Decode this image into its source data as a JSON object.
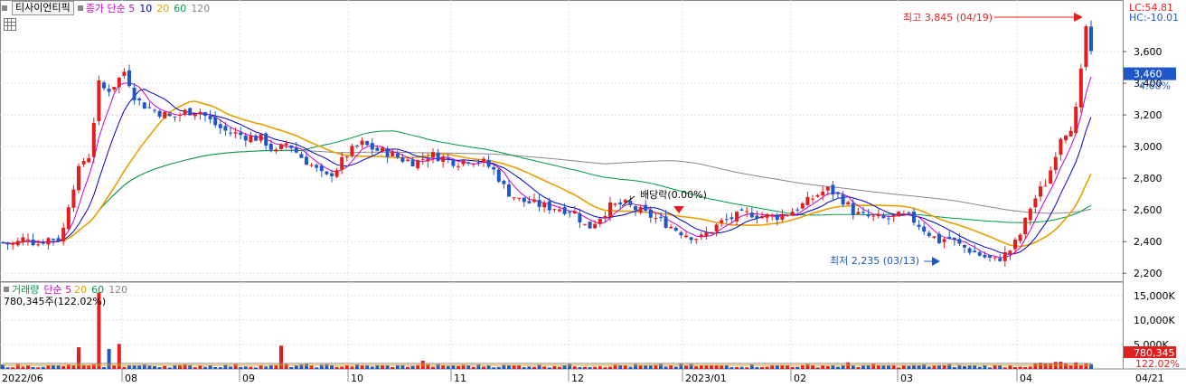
{
  "legend": {
    "title": "티사이언티픽",
    "items": [
      {
        "text": "종가 단순 5",
        "color": "#cc00cc"
      },
      {
        "text": "10",
        "color": "#0000cc"
      },
      {
        "text": "20",
        "color": "#e8a000"
      },
      {
        "text": "60",
        "color": "#009944"
      },
      {
        "text": "120",
        "color": "#888888"
      }
    ]
  },
  "volume_legend": {
    "items": [
      {
        "text": "거래량",
        "color": "#009944"
      },
      {
        "text": "단순 5",
        "color": "#cc00cc"
      },
      {
        "text": "20",
        "color": "#e8a000"
      },
      {
        "text": "60",
        "color": "#009944"
      },
      {
        "text": "120",
        "color": "#888888"
      }
    ],
    "summary": "780,345주(122.02%)"
  },
  "right_info": {
    "lc": "LC:54.81",
    "hc": "HC:-10.01"
  },
  "colors": {
    "up": "#e21f1f",
    "down": "#1f56c8",
    "grid": "#dddddd"
  },
  "chart_data": {
    "type": "candlestick",
    "price_axis": {
      "range": [
        2150,
        3880
      ],
      "ticks": [
        "2,200",
        "2,400",
        "2,600",
        "2,800",
        "3,000",
        "3,200",
        "3,400",
        "3,600"
      ]
    },
    "volume_axis": {
      "range": [
        0,
        17000
      ],
      "ticks": [
        "5,000K",
        "10,000K",
        "15,000K"
      ]
    },
    "x_labels": [
      "2022/06",
      "08",
      "09",
      "10",
      "11",
      "12",
      "2023/01",
      "02",
      "03",
      "04"
    ],
    "last_date_label": "04/21",
    "current_price": "3,460",
    "current_change": "-4.68%",
    "current_volume": "780,345",
    "current_volume_ratio": "122.02%",
    "annotations": {
      "high": "최고 3,845 (04/19)",
      "low": "최저 2,235 (03/13)",
      "dividend": "배당락(0.00%)"
    },
    "ma_colors": {
      "ma5": "#cc00cc",
      "ma10": "#0000cc",
      "ma20": "#e8a000",
      "ma60": "#009944",
      "ma120": "#888888"
    },
    "keypoints": [
      [
        0,
        2400
      ],
      [
        12,
        2380
      ],
      [
        22,
        2400
      ],
      [
        30,
        2440
      ],
      [
        40,
        2380
      ],
      [
        52,
        2420
      ],
      [
        68,
        2420
      ],
      [
        78,
        2700
      ],
      [
        90,
        2900
      ],
      [
        100,
        2950
      ],
      [
        108,
        3400
      ],
      [
        118,
        3350
      ],
      [
        128,
        3400
      ],
      [
        138,
        3480
      ],
      [
        150,
        3300
      ],
      [
        162,
        3250
      ],
      [
        175,
        3220
      ],
      [
        190,
        3180
      ],
      [
        205,
        3220
      ],
      [
        220,
        3230
      ],
      [
        235,
        3150
      ],
      [
        248,
        3100
      ],
      [
        262,
        3080
      ],
      [
        275,
        3060
      ],
      [
        290,
        3050
      ],
      [
        305,
        2960
      ],
      [
        318,
        3030
      ],
      [
        330,
        2950
      ],
      [
        345,
        2880
      ],
      [
        360,
        2800
      ],
      [
        372,
        2860
      ],
      [
        385,
        2960
      ],
      [
        400,
        3020
      ],
      [
        415,
        2980
      ],
      [
        430,
        2960
      ],
      [
        445,
        2920
      ],
      [
        460,
        2900
      ],
      [
        475,
        2950
      ],
      [
        490,
        2930
      ],
      [
        505,
        2900
      ],
      [
        520,
        2920
      ],
      [
        535,
        2900
      ],
      [
        548,
        2840
      ],
      [
        560,
        2720
      ],
      [
        575,
        2660
      ],
      [
        590,
        2640
      ],
      [
        605,
        2620
      ],
      [
        620,
        2610
      ],
      [
        635,
        2590
      ],
      [
        650,
        2480
      ],
      [
        662,
        2550
      ],
      [
        675,
        2620
      ],
      [
        690,
        2640
      ],
      [
        705,
        2600
      ],
      [
        720,
        2560
      ],
      [
        735,
        2520
      ],
      [
        750,
        2470
      ],
      [
        762,
        2440
      ],
      [
        775,
        2420
      ],
      [
        788,
        2480
      ],
      [
        800,
        2530
      ],
      [
        815,
        2560
      ],
      [
        830,
        2580
      ],
      [
        845,
        2560
      ],
      [
        860,
        2560
      ],
      [
        875,
        2590
      ],
      [
        890,
        2640
      ],
      [
        905,
        2700
      ],
      [
        915,
        2730
      ],
      [
        925,
        2700
      ],
      [
        935,
        2650
      ],
      [
        945,
        2580
      ],
      [
        955,
        2560
      ],
      [
        968,
        2550
      ],
      [
        980,
        2540
      ],
      [
        992,
        2560
      ],
      [
        1005,
        2560
      ],
      [
        1018,
        2500
      ],
      [
        1030,
        2440
      ],
      [
        1040,
        2400
      ],
      [
        1048,
        2430
      ],
      [
        1060,
        2380
      ],
      [
        1075,
        2340
      ],
      [
        1090,
        2300
      ],
      [
        1100,
        2280
      ],
      [
        1110,
        2310
      ],
      [
        1120,
        2360
      ],
      [
        1130,
        2460
      ],
      [
        1140,
        2620
      ],
      [
        1150,
        2720
      ],
      [
        1158,
        2780
      ],
      [
        1165,
        2900
      ],
      [
        1172,
        3060
      ],
      [
        1180,
        3100
      ],
      [
        1188,
        3150
      ],
      [
        1195,
        3400
      ],
      [
        1200,
        3800
      ],
      [
        1205,
        3650
      ],
      [
        1210,
        3460
      ]
    ],
    "volume_spikes": [
      [
        85,
        0.26
      ],
      [
        110,
        0.92
      ],
      [
        118,
        0.24
      ],
      [
        133,
        0.3
      ],
      [
        312,
        0.28
      ],
      [
        466,
        0.1
      ],
      [
        938,
        0.08
      ]
    ]
  }
}
